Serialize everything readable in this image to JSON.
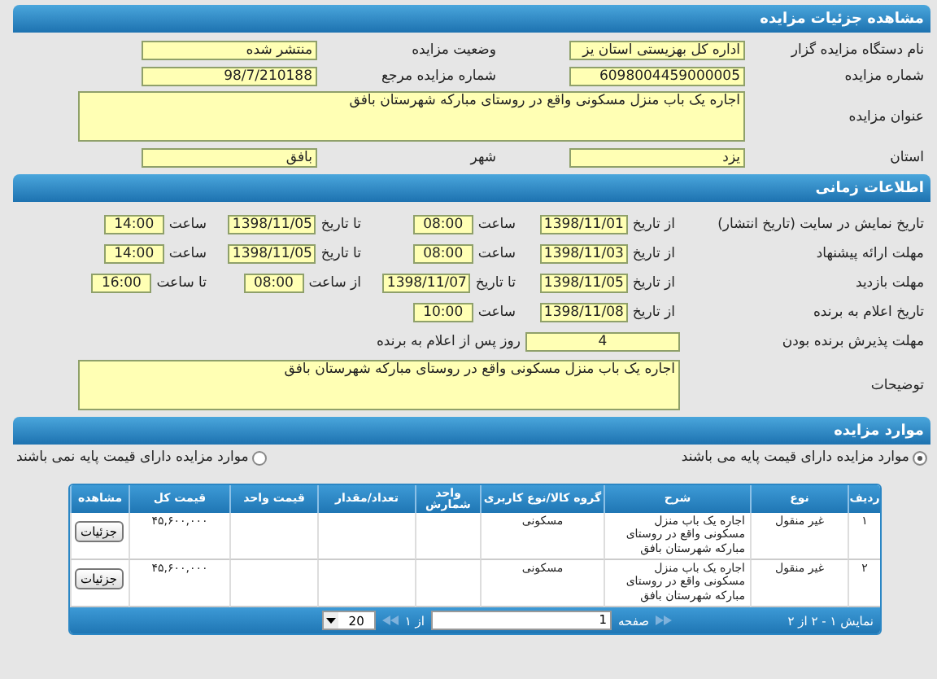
{
  "header": {
    "title": "مشاهده جزئیات مزایده"
  },
  "general": {
    "pairs": [
      {
        "label": "نام دستگاه مزایده گزار",
        "value": "اداره کل بهزیستی استان یز"
      },
      {
        "label": "وضعیت مزایده",
        "value": "منتشر شده"
      },
      {
        "label": "شماره مزایده",
        "value": "6098004459000005"
      },
      {
        "label": "شماره مزایده مرجع",
        "value": "98/7/210188"
      }
    ],
    "title": {
      "label": "عنوان مزایده",
      "value": "اجاره یک باب منزل مسکونی واقع در روستای مبارکه شهرستان بافق"
    },
    "location": [
      {
        "label": "استان",
        "value": "یزد"
      },
      {
        "label": "شهر",
        "value": "بافق"
      }
    ]
  },
  "timing": {
    "title": "اطلاعات زمانی",
    "rows": [
      {
        "label": "تاریخ نمایش در سایت (تاریخ انتشار)",
        "cells": [
          {
            "label": "از تاریخ",
            "value": "1398/11/01",
            "kind": "date"
          },
          {
            "label": "ساعت",
            "value": "08:00",
            "kind": "time"
          },
          {
            "label": "تا تاریخ",
            "value": "1398/11/05",
            "kind": "date"
          },
          {
            "label": "ساعت",
            "value": "14:00",
            "kind": "time"
          }
        ]
      },
      {
        "label": "مهلت ارائه پیشنهاد",
        "cells": [
          {
            "label": "از تاریخ",
            "value": "1398/11/03",
            "kind": "date"
          },
          {
            "label": "ساعت",
            "value": "08:00",
            "kind": "time"
          },
          {
            "label": "تا تاریخ",
            "value": "1398/11/05",
            "kind": "date"
          },
          {
            "label": "ساعت",
            "value": "14:00",
            "kind": "time"
          }
        ]
      },
      {
        "label": "مهلت بازدید",
        "cells": [
          {
            "label": "از تاریخ",
            "value": "1398/11/05",
            "kind": "date"
          },
          {
            "label": "تا تاریخ",
            "value": "1398/11/07",
            "kind": "date"
          },
          {
            "label": "از ساعت",
            "value": "08:00",
            "kind": "time"
          },
          {
            "label": "تا ساعت",
            "value": "16:00",
            "kind": "time"
          }
        ]
      },
      {
        "label": "تاریخ اعلام به برنده",
        "cells": [
          {
            "label": "از تاریخ",
            "value": "1398/11/08",
            "kind": "date"
          },
          {
            "label": "ساعت",
            "value": "10:00",
            "kind": "time"
          }
        ]
      }
    ],
    "acceptance": {
      "label": "مهلت پذیرش برنده بودن",
      "value": "4",
      "suffix": "روز پس از اعلام به برنده"
    },
    "description": {
      "label": "توضیحات",
      "value": "اجاره یک باب منزل مسکونی واقع در روستای مبارکه شهرستان بافق"
    }
  },
  "items": {
    "title": "موارد مزایده",
    "options": [
      {
        "label": "موارد مزایده دارای قیمت پایه می باشند",
        "selected": true
      },
      {
        "label": "موارد مزایده دارای قیمت پایه نمی باشند",
        "selected": false
      }
    ],
    "columns": [
      {
        "label": "ردیف",
        "kind": "text"
      },
      {
        "label": "نوع",
        "kind": "text"
      },
      {
        "label": "شرح",
        "kind": "text"
      },
      {
        "label": "گروه کالا/نوع کاربری",
        "kind": "text"
      },
      {
        "label": "واحد شمارش",
        "kind": "text"
      },
      {
        "label": "تعداد/مقدار",
        "kind": "text"
      },
      {
        "label": "قیمت واحد",
        "kind": "text"
      },
      {
        "label": "قیمت کل",
        "kind": "text"
      },
      {
        "label": "مشاهده",
        "kind": "action"
      }
    ],
    "rows": [
      {
        "cells": [
          "۱",
          "غیر منقول",
          "اجاره یک باب منزل مسکونی واقع در روستای مبارکه شهرستان بافق",
          "مسکونی",
          null,
          null,
          null,
          "۴۵,۶۰۰,۰۰۰",
          "جزئیات"
        ]
      },
      {
        "cells": [
          "۲",
          "غیر منقول",
          "اجاره یک باب منزل مسکونی واقع در روستای مبارکه شهرستان بافق",
          "مسکونی",
          null,
          null,
          null,
          "۴۵,۶۰۰,۰۰۰",
          "جزئیات"
        ]
      }
    ],
    "pager": {
      "summary": "نمایش ۱ - ۲ از ۲",
      "page_label": "صفحه",
      "page": "1",
      "of": "از ۱",
      "page_size": "20"
    }
  }
}
